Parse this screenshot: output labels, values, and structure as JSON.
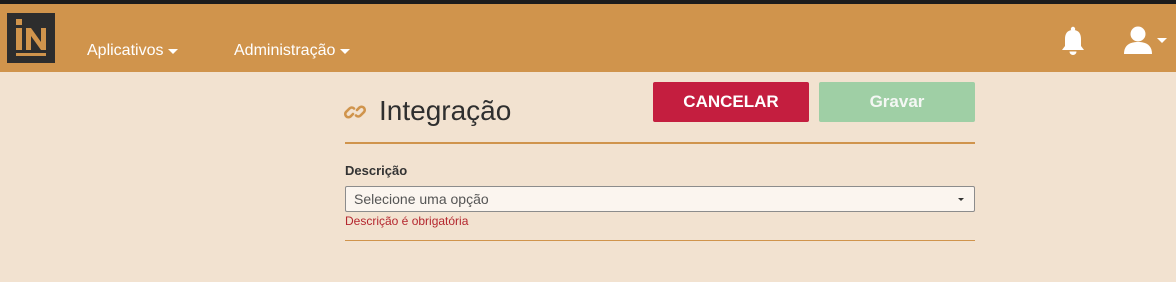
{
  "navbar": {
    "logo_text": "IN",
    "menu": [
      {
        "label": "Aplicativos"
      },
      {
        "label": "Administração"
      }
    ],
    "icons": {
      "notifications": "bell-icon",
      "user": "user-icon"
    }
  },
  "page": {
    "title": "Integração",
    "title_icon": "link-icon"
  },
  "actions": {
    "cancel_label": "CANCELAR",
    "save_label": "Gravar",
    "save_enabled": false
  },
  "form": {
    "description_label": "Descrição",
    "description_placeholder": "Selecione uma opção",
    "description_error": "Descrição é obrigatória"
  },
  "colors": {
    "navbar": "#d0944c",
    "background": "#f2e2d0",
    "cancel": "#c41e3f",
    "save_disabled": "#9fcfa5",
    "error": "#b4262e"
  }
}
